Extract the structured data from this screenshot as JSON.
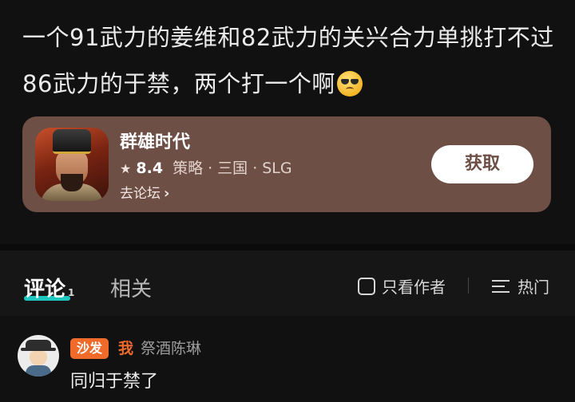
{
  "post": {
    "text": "一个91武力的姜维和82武力的关兴合力单挑打不过86武力的于禁，两个打一个啊",
    "emoji": "sunglasses-frown-emoji"
  },
  "game_card": {
    "title": "群雄时代",
    "rating": "8.4",
    "tags": [
      "策略",
      "三国",
      "SLG"
    ],
    "forum_link": "去论坛",
    "get_button": "获取",
    "card_color": "#6e4f46"
  },
  "tabs": {
    "comments_label": "评论",
    "comments_count": "1",
    "related_label": "相关",
    "author_only": "只看作者",
    "sort_label": "热门",
    "accent_color": "#1fc7c1"
  },
  "comment": {
    "badge": "沙发",
    "me_tag": "我",
    "username": "祭酒陈琳",
    "text": "同归于禁了",
    "badge_color": "#f06a2a"
  }
}
